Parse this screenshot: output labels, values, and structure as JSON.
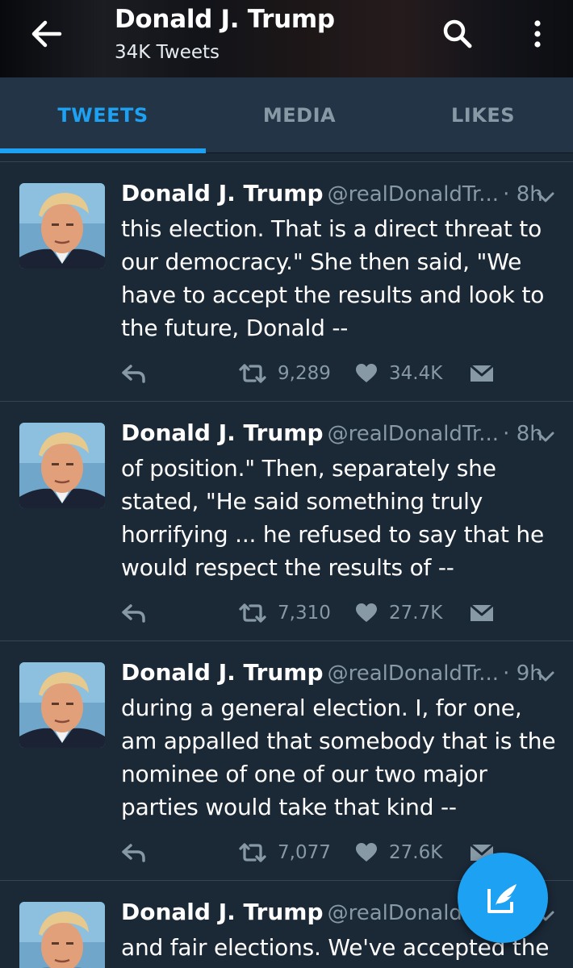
{
  "header": {
    "title": "Donald J. Trump",
    "subtitle": "34K Tweets"
  },
  "tabs": [
    {
      "label": "TWEETS",
      "active": true
    },
    {
      "label": "MEDIA",
      "active": false
    },
    {
      "label": "LIKES",
      "active": false
    }
  ],
  "tweets": [
    {
      "name": "Donald J. Trump",
      "handle": "@realDonaldTr...",
      "time": "8h",
      "text": "this election. That is a direct threat to our democracy.\" She then said, \"We have to accept the results and look to the future, Donald --",
      "retweets": "9,289",
      "likes": "34.4K"
    },
    {
      "name": "Donald J. Trump",
      "handle": "@realDonaldTr...",
      "time": "8h",
      "text": "of position.\" Then, separately she stated, \"He said something truly horrifying ... he refused to say that he would respect the results of --",
      "retweets": "7,310",
      "likes": "27.7K"
    },
    {
      "name": "Donald J. Trump",
      "handle": "@realDonaldTr...",
      "time": "9h",
      "text": "during a general election. I, for one, am appalled that somebody that is the nominee of one of our two major parties would take that kind --",
      "retweets": "7,077",
      "likes": "27.6K"
    },
    {
      "name": "Donald J. Trump",
      "handle": "@realDonaldTr...",
      "time": "",
      "text": "and fair elections. We've accepted the"
    }
  ],
  "icons": {
    "back": "arrow-left-icon",
    "search": "search-icon",
    "more": "more-vertical-icon",
    "reply": "reply-icon",
    "retweet": "retweet-icon",
    "like": "heart-icon",
    "dm": "direct-message-icon",
    "compose": "compose-tweet-icon"
  },
  "colors": {
    "accent": "#1da1f2",
    "background": "#1b2836",
    "tabbar": "#243447",
    "muted": "#8899a6"
  }
}
